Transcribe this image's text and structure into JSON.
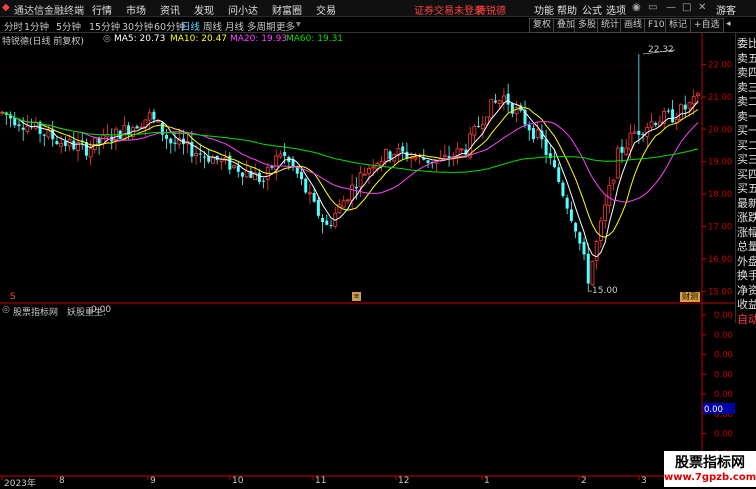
{
  "titlebar": {
    "app_title": "通达信金融终端",
    "menu": [
      "行情",
      "市场",
      "资讯",
      "发现",
      "问小达",
      "财富圈",
      "交易"
    ],
    "notice": "证券交易未登录",
    "stock": "特锐德",
    "right_menu": [
      "功能",
      "帮助",
      "公式",
      "选项"
    ],
    "guest": "游客"
  },
  "toolbar": {
    "periods": [
      "分时",
      "1分钟",
      "5分钟",
      "15分钟",
      "30分钟",
      "60分钟",
      "日线",
      "周线",
      "月线",
      "多周期",
      "更多"
    ],
    "active_period": "日线",
    "buttons": [
      "复权",
      "叠加",
      "多股",
      "统计",
      "画线",
      "F10",
      "标记",
      "+自选"
    ]
  },
  "legend": {
    "stock_label": "特锐德(日线 前复权)",
    "ma5": "MA5: 20.73",
    "ma10": "MA10: 20.47",
    "ma20": "MA20: 19.93",
    "ma60": "MA60: 19.31"
  },
  "price_axis": {
    "max_label": "22.32",
    "min_label": "15.00",
    "ticks": [
      "22.00",
      "21.00",
      "20.00",
      "19.00",
      "18.00",
      "17.00",
      "16.00",
      "15.00"
    ]
  },
  "sidebar": {
    "items": [
      "委比",
      "卖五",
      "卖四",
      "卖三",
      "卖二",
      "卖一",
      "买一",
      "买二",
      "买三",
      "买四",
      "买五",
      "最新",
      "涨跌",
      "涨幅",
      "总量",
      "外盘",
      "换手",
      "净资",
      "收益",
      "自动"
    ]
  },
  "markers": {
    "left_s": "S",
    "mid_box": "≡",
    "finance": "财测"
  },
  "indicator": {
    "source": "股票指标网",
    "name": "妖股重生:",
    "value": "0.00",
    "ticks": [
      "0.00",
      "0.00",
      "0.00",
      "0.00",
      "0.00",
      "0.00",
      "0.00",
      "0.00",
      "0.00"
    ],
    "highlight_tick": "0.00"
  },
  "date_axis": {
    "labels": [
      "2023年",
      "8",
      "9",
      "10",
      "11",
      "12",
      "1",
      "2",
      "3"
    ]
  },
  "watermark": {
    "cn": "股票指标网",
    "url": "www.7gpzb.com"
  },
  "colors": {
    "up": "#ff3c3c",
    "down": "#54ffff",
    "ma5": "#ffffff",
    "ma10": "#ffff00",
    "ma20": "#ff40ff",
    "ma60": "#00e000",
    "axis_red": "#c00000"
  }
}
